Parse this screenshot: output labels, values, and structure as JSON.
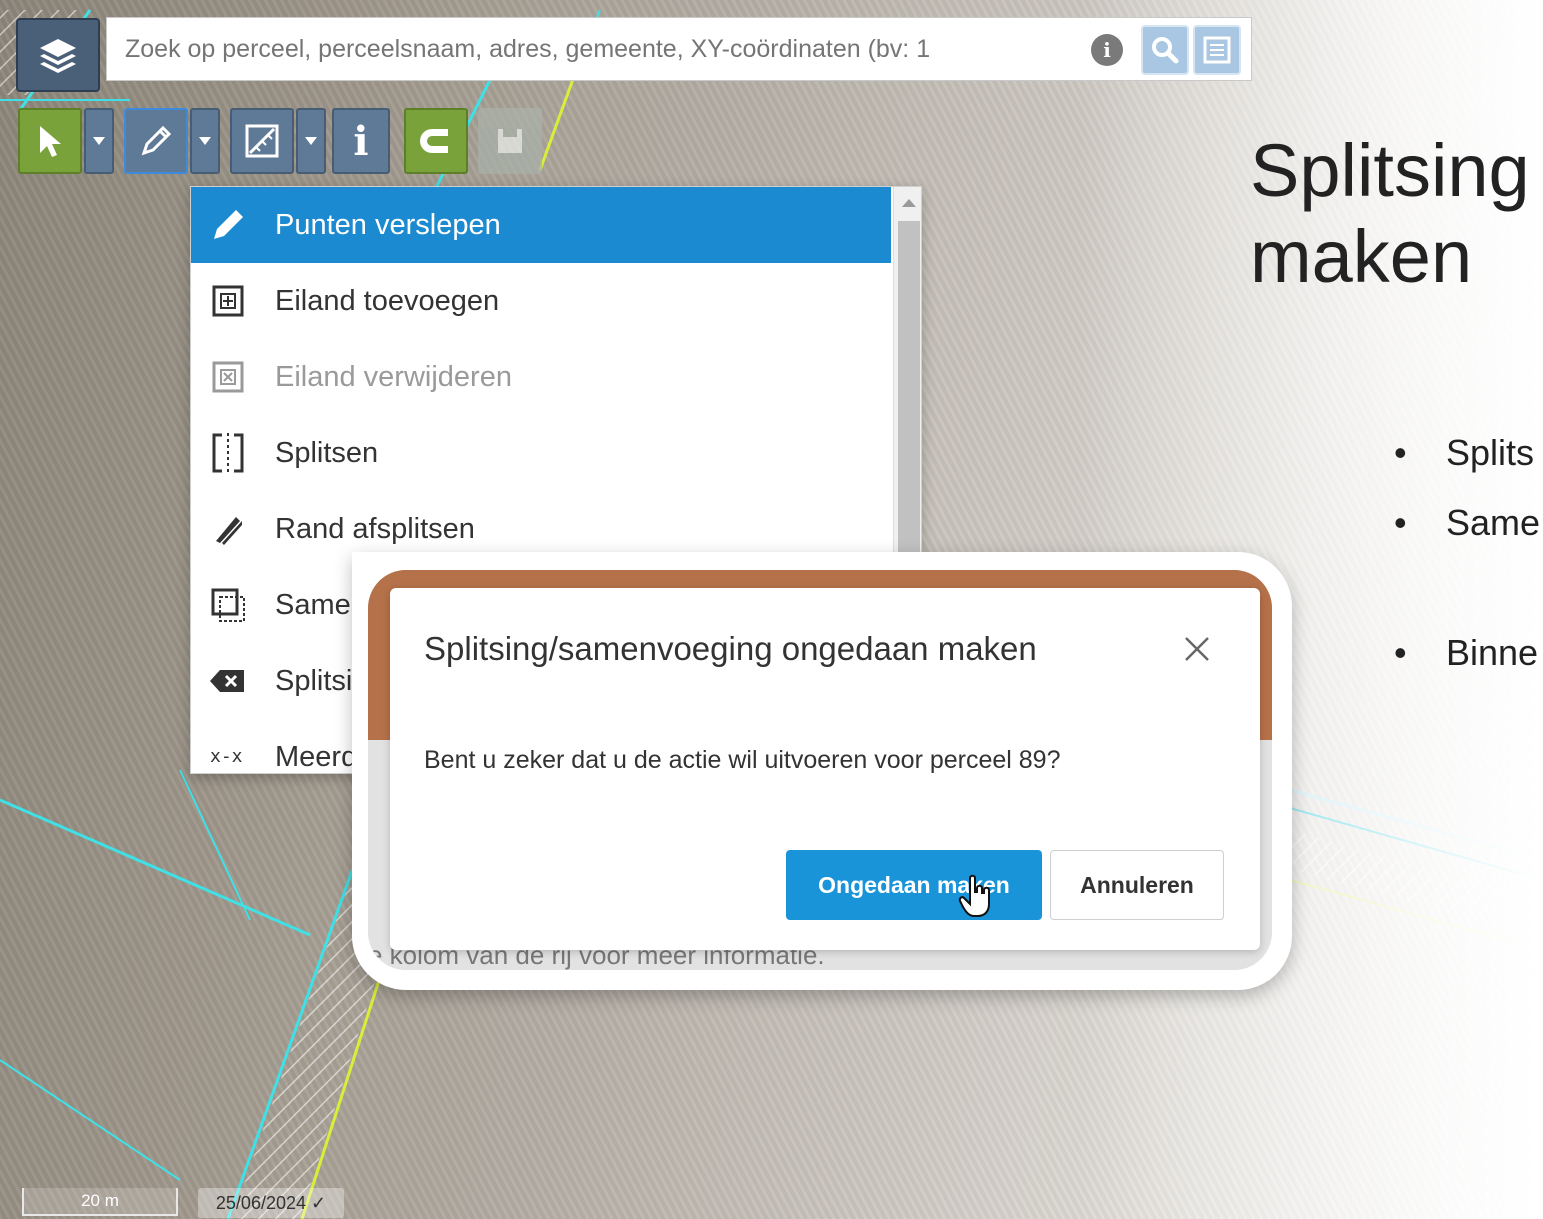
{
  "search": {
    "placeholder": "Zoek op perceel, perceelsnaam, adres, gemeente, XY-coördinaten (bv: 1"
  },
  "menu": {
    "items": [
      {
        "label": "Punten verslepen",
        "icon": "pencil-icon",
        "state": "active"
      },
      {
        "label": "Eiland toevoegen",
        "icon": "island-add-icon",
        "state": "normal"
      },
      {
        "label": "Eiland verwijderen",
        "icon": "island-remove-icon",
        "state": "disabled"
      },
      {
        "label": "Splitsen",
        "icon": "split-icon",
        "state": "normal"
      },
      {
        "label": "Rand afsplitsen",
        "icon": "edge-split-icon",
        "state": "normal"
      },
      {
        "label": "Samer",
        "icon": "merge-icon",
        "state": "normal"
      },
      {
        "label": "Splitsi",
        "icon": "backspace-icon",
        "state": "normal"
      },
      {
        "label": "Meerd",
        "icon": "multi-icon",
        "state": "normal"
      }
    ]
  },
  "slide": {
    "title_line1": "Splitsing",
    "title_line2": "maken",
    "bullets": [
      "Splits",
      "Same",
      "Binne"
    ]
  },
  "modal": {
    "title": "Splitsing/samenvoeging ongedaan maken",
    "body": "Bent u zeker dat u de actie wil uitvoeren voor perceel 89?",
    "confirm_label": "Ongedaan maken",
    "cancel_label": "Annuleren",
    "background_text": "e kolom van de rij voor meer informatie."
  },
  "status": {
    "scale": "20 m",
    "date": "25/06/2024 ✓"
  },
  "colors": {
    "accent": "#1b8ad1",
    "tool_green": "#7aa23a",
    "tool_slate": "#5f7a96",
    "panel_brown": "#b5714a"
  }
}
